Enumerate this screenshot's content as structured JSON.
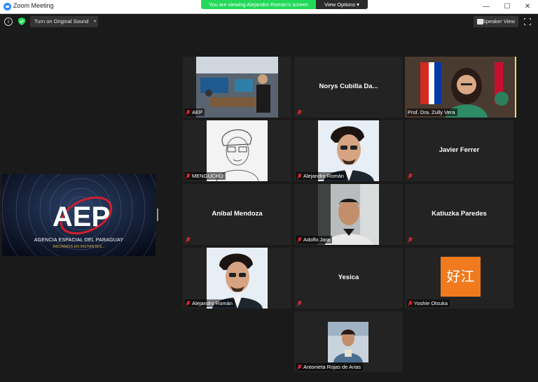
{
  "window": {
    "title": "Zoom Meeting",
    "minimize_glyph": "—",
    "maximize_glyph": "☐",
    "close_glyph": "✕"
  },
  "banner": {
    "viewing_text": "You are viewing Alejandro Román's screen",
    "view_options_label": "View Options ▾"
  },
  "toolbar": {
    "info_glyph": "i",
    "original_sound_label": "Turn on Original Sound",
    "sound_caret": "▾",
    "speaker_view_label": "Speaker View"
  },
  "shared_screen": {
    "org_name": "AGENCIA ESPACIAL DEL PARAGUAY",
    "subtitle": "INICIAMOS EN INSTANTES...",
    "logo_text": "AEP"
  },
  "avatar_text": "好江",
  "participants": [
    {
      "name": "AEP",
      "muted": true,
      "video": "photo"
    },
    {
      "name": "Norys Cubilla Da...",
      "muted": true,
      "video": "none"
    },
    {
      "name": "Prof. Dra. Zully Vera",
      "muted": false,
      "video": "photo",
      "speaking": true
    },
    {
      "name": "MENGUCHO",
      "muted": true,
      "video": "photo"
    },
    {
      "name": "Alejandro Román",
      "muted": true,
      "video": "photo"
    },
    {
      "name": "Javier Ferrer",
      "muted": true,
      "video": "none"
    },
    {
      "name": "Anibal Mendoza",
      "muted": true,
      "video": "none"
    },
    {
      "name": "Adolfo Jara",
      "muted": true,
      "video": "photo"
    },
    {
      "name": "Katiuzka Paredes",
      "muted": true,
      "video": "none"
    },
    {
      "name": "Alejandro Román",
      "muted": true,
      "video": "photo"
    },
    {
      "name": "Yesica",
      "muted": true,
      "video": "none"
    },
    {
      "name": "Yoshie Otsuka",
      "muted": true,
      "video": "avatar"
    },
    {
      "name": "Antonieta Rojas de Arias",
      "muted": true,
      "video": "photo"
    }
  ],
  "colors": {
    "banner_green": "#23d959",
    "active_speaker": "#e1e45f",
    "muted_red": "#e02828",
    "avatar_orange": "#f07a1e"
  }
}
